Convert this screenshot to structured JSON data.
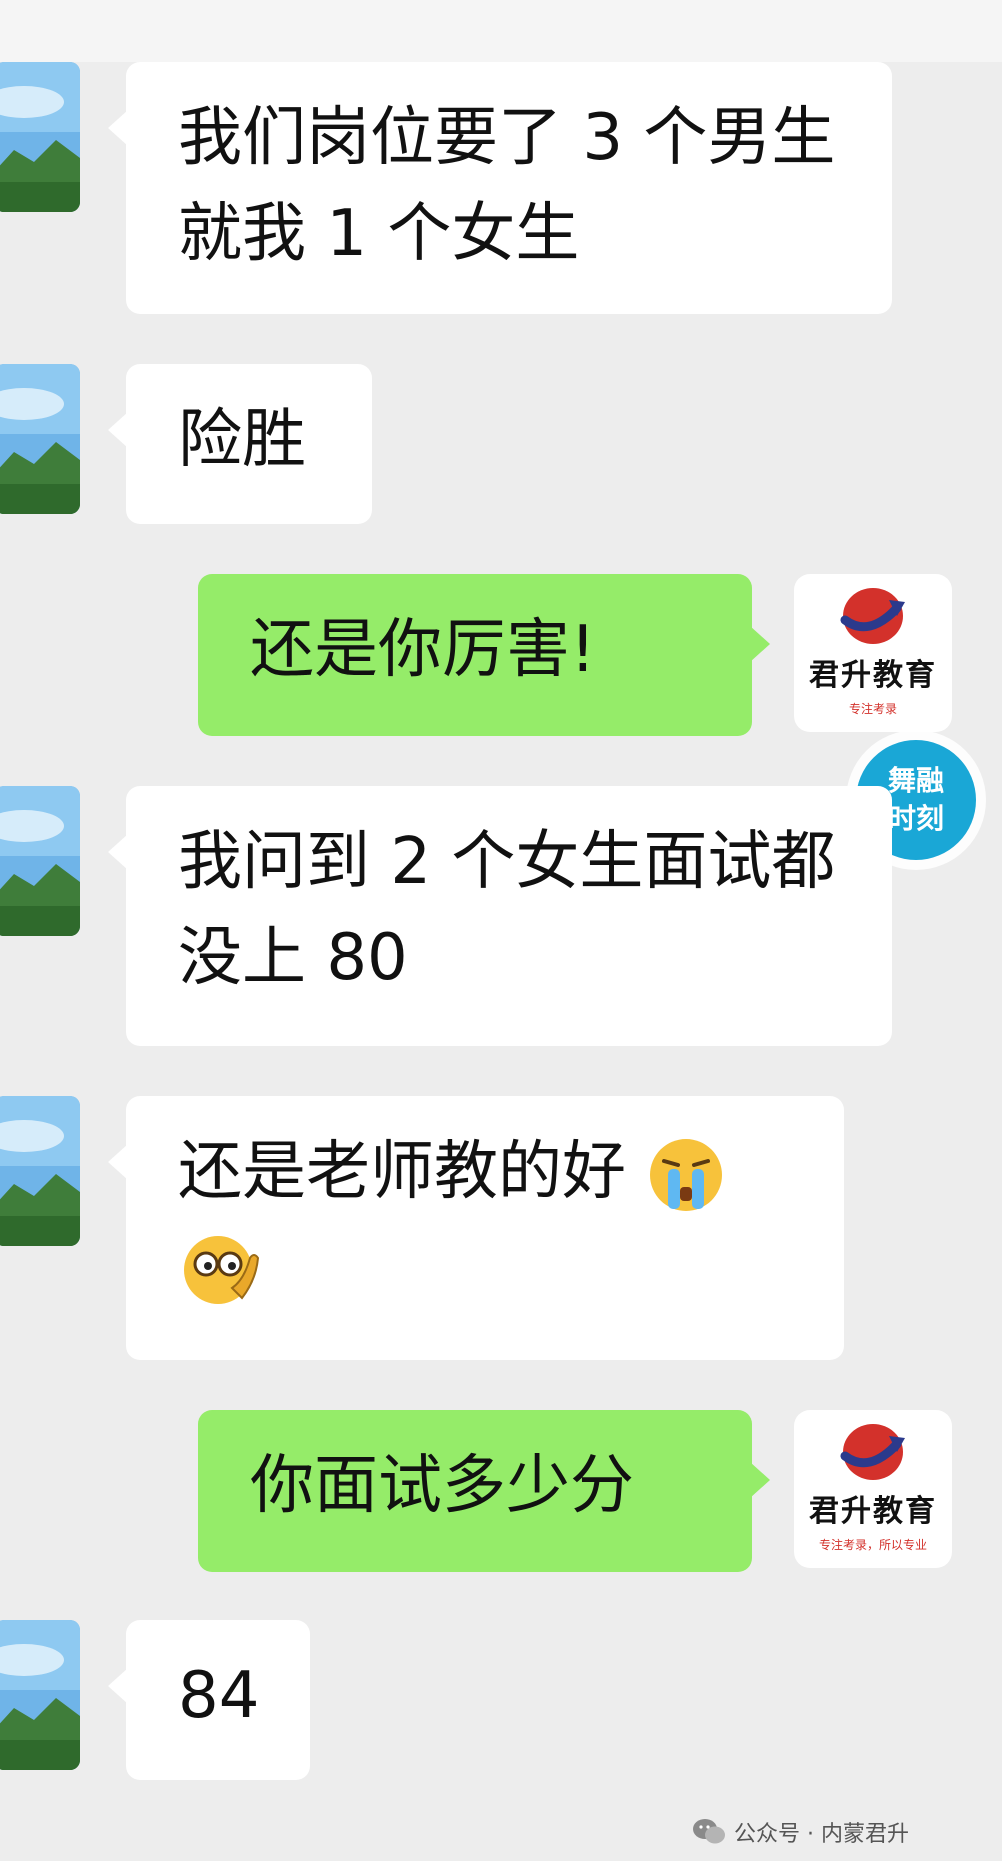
{
  "messages": [
    {
      "side": "left",
      "text": "我们岗位要了 3 个男生 就我 1 个女生"
    },
    {
      "side": "left",
      "text": "险胜"
    },
    {
      "side": "right",
      "text": "还是你厉害!"
    },
    {
      "side": "left",
      "text": "我问到 2 个女生面试都没上 80"
    },
    {
      "side": "left",
      "text": "还是老师教的好"
    },
    {
      "side": "right",
      "text": "你面试多少分"
    },
    {
      "side": "left",
      "text": "84"
    }
  ],
  "emojis": {
    "crying": "crying-face-icon",
    "peek": "peeking-face-icon"
  },
  "brand_avatar": {
    "name": "君升教育",
    "slogan_1": "专注考录",
    "slogan_2": "专注考录，所以专业",
    "colors": {
      "red": "#d3312b",
      "blue": "#2b3a8c"
    }
  },
  "overlay": {
    "line1": "舞融",
    "line2": "时刻"
  },
  "footer": {
    "text": "公众号 · 内蒙君升"
  },
  "colors": {
    "background": "#ededed",
    "left_bubble": "#ffffff",
    "right_bubble": "#95ec69"
  }
}
